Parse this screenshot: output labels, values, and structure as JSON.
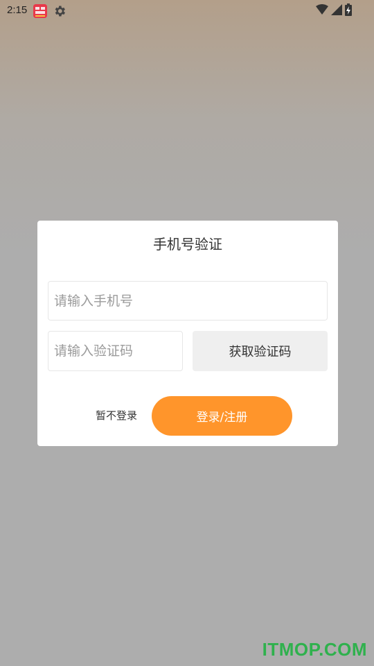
{
  "status_bar": {
    "time": "2:15",
    "icons": [
      "app-notification-icon",
      "settings-gear-icon",
      "wifi-icon",
      "cellular-signal-icon",
      "battery-charging-icon"
    ]
  },
  "dialog": {
    "title": "手机号验证",
    "phone_placeholder": "请输入手机号",
    "phone_value": "",
    "code_placeholder": "请输入验证码",
    "code_value": "",
    "get_code_label": "获取验证码",
    "skip_label": "暂不登录",
    "login_label": "登录/注册"
  },
  "colors": {
    "accent": "#ff952b",
    "get_code_bg": "#efefef",
    "watermark": "#2fb14d"
  },
  "watermark": "ITMOP.COM"
}
